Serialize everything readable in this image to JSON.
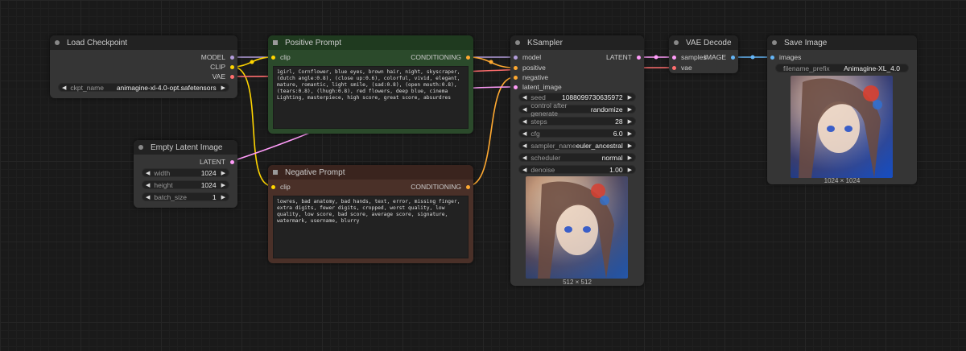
{
  "nodes": {
    "load_checkpoint": {
      "title": "Load Checkpoint",
      "outputs": [
        "MODEL",
        "CLIP",
        "VAE"
      ],
      "widgets": [
        {
          "label": "ckpt_name",
          "value": "animagine-xl-4.0-opt.safetensors"
        }
      ]
    },
    "empty_latent": {
      "title": "Empty Latent Image",
      "outputs": [
        "LATENT"
      ],
      "widgets": [
        {
          "label": "width",
          "value": "1024"
        },
        {
          "label": "height",
          "value": "1024"
        },
        {
          "label": "batch_size",
          "value": "1"
        }
      ]
    },
    "positive_prompt": {
      "title": "Positive Prompt",
      "input": "clip",
      "output": "CONDITIONING",
      "text": "1girl, Cornflower, blue eyes, brown hair, night, skyscraper, (dutch angle:0.8), (close up:0.6), colorful, vivid, elegant, mature, romantic, light smile, (sad:0.8), (open mouth:0.8), (tears:0.8), (lhugh:0.8), red flowers, deep blue, cinema Lighting, masterpiece, high score, great score, absurdres"
    },
    "negative_prompt": {
      "title": "Negative Prompt",
      "input": "clip",
      "output": "CONDITIONING",
      "text": "lowres, bad anatomy, bad hands, text, error, missing finger, extra digits, fewer digits, cropped, worst quality, low quality, low score, bad score, average score, signature, watermark, username, blurry"
    },
    "ksampler": {
      "title": "KSampler",
      "inputs": [
        "model",
        "positive",
        "negative",
        "latent_image"
      ],
      "output": "LATENT",
      "widgets": [
        {
          "label": "seed",
          "value": "1088099730635972"
        },
        {
          "label": "control after generate",
          "value": "randomize"
        },
        {
          "label": "steps",
          "value": "28"
        },
        {
          "label": "cfg",
          "value": "6.0"
        },
        {
          "label": "sampler_name",
          "value": "euler_ancestral"
        },
        {
          "label": "scheduler",
          "value": "normal"
        },
        {
          "label": "denoise",
          "value": "1.00"
        }
      ],
      "preview_caption": "512 × 512"
    },
    "vae_decode": {
      "title": "VAE Decode",
      "inputs": [
        "samples",
        "vae"
      ],
      "output": "IMAGE"
    },
    "save_image": {
      "title": "Save Image",
      "input": "images",
      "widgets": [
        {
          "label": "filename_prefix",
          "value": "Animagine-XL_4.0"
        }
      ],
      "preview_caption": "1024 × 1024"
    }
  },
  "colors": {
    "model": "#b39ddb",
    "clip": "#ffd500",
    "vae": "#ff6e6e",
    "conditioning": "#ffa931",
    "latent": "#ff9cf9",
    "image": "#64b5f6",
    "positive_bg": "#2b4a2b",
    "negative_bg": "#4a3028"
  }
}
